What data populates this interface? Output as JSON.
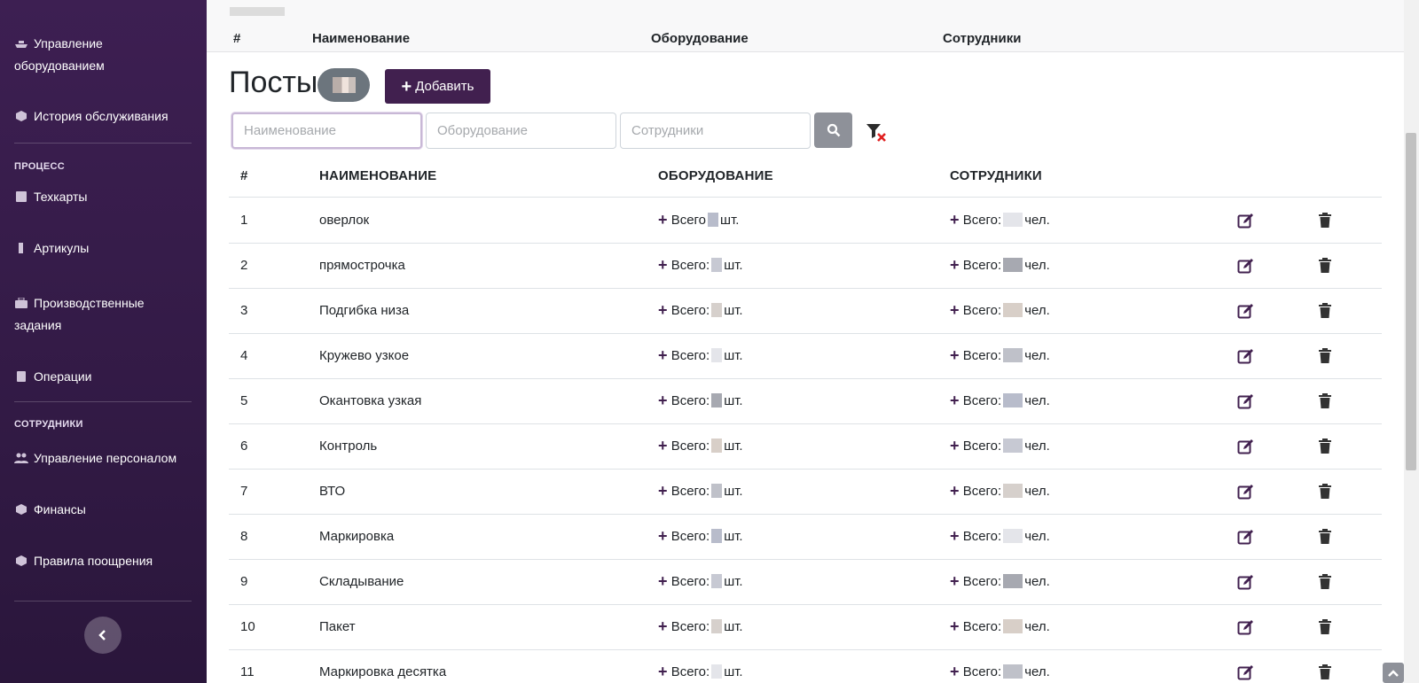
{
  "sidebar": {
    "items": [
      {
        "label": "Управление оборудованием",
        "icon": "ship-icon"
      },
      {
        "label": "История обслуживания",
        "icon": "cube-icon"
      },
      {
        "label": "Техкарты",
        "icon": "book-icon"
      },
      {
        "label": "Артикулы",
        "icon": "tag-icon"
      },
      {
        "label": "Производственные задания",
        "icon": "briefcase-icon"
      },
      {
        "label": "Операции",
        "icon": "clipboard-icon"
      },
      {
        "label": "Управление персоналом",
        "icon": "users-icon"
      },
      {
        "label": "Финансы",
        "icon": "cube-icon"
      },
      {
        "label": "Правила поощрения",
        "icon": "cube-icon"
      }
    ],
    "sections": {
      "process": "ПРОЦЕСС",
      "employees": "СОТРУДНИКИ"
    }
  },
  "sticky_header": {
    "num": "#",
    "name": "Наименование",
    "equipment": "Оборудование",
    "employees": "Сотрудники"
  },
  "page": {
    "title": "Посты",
    "add_label": "Добавить"
  },
  "filters": {
    "name_placeholder": "Наименование",
    "equipment_placeholder": "Оборудование",
    "employees_placeholder": "Сотрудники"
  },
  "table": {
    "headers": {
      "num": "#",
      "name": "НАИМЕНОВАНИЕ",
      "equipment": "ОБОРУДОВАНИЕ",
      "employees": "СОТРУДНИКИ"
    },
    "equipment_prefix": "Всего:",
    "equipment_prefix_first": "Всего",
    "equipment_unit": "шт.",
    "employees_prefix": "Всего:",
    "employees_unit": "чел.",
    "rows": [
      {
        "num": "1",
        "name": "оверлок"
      },
      {
        "num": "2",
        "name": "прямострочка"
      },
      {
        "num": "3",
        "name": "Подгибка низа"
      },
      {
        "num": "4",
        "name": "Кружево узкое"
      },
      {
        "num": "5",
        "name": "Окантовка узкая"
      },
      {
        "num": "6",
        "name": "Контроль"
      },
      {
        "num": "7",
        "name": "ВТО"
      },
      {
        "num": "8",
        "name": "Маркировка"
      },
      {
        "num": "9",
        "name": "Складывание"
      },
      {
        "num": "10",
        "name": "Пакет"
      },
      {
        "num": "11",
        "name": "Маркировка десятка"
      }
    ]
  },
  "colors": {
    "sidebar_bg": "#3d1f52",
    "accent": "#41204f",
    "search_button": "#8e9199"
  }
}
